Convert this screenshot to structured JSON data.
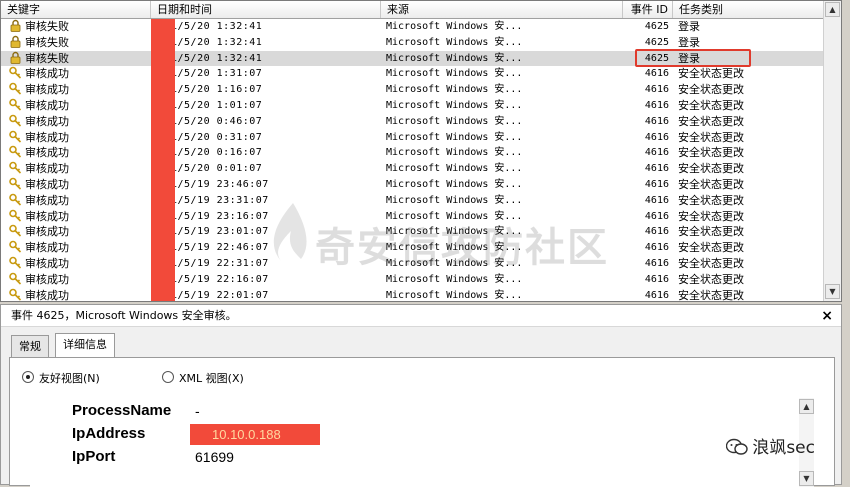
{
  "list": {
    "columns": [
      "关键字",
      "日期和时间",
      "来源",
      "事件 ID",
      "任务类别"
    ],
    "rows": [
      {
        "kw": "审核失败",
        "dt": "1/5/20 1:32:41",
        "src": "Microsoft Windows 安...",
        "id": "4625",
        "cat": "登录",
        "icon": "lock-icon"
      },
      {
        "kw": "审核失败",
        "dt": "1/5/20 1:32:41",
        "src": "Microsoft Windows 安...",
        "id": "4625",
        "cat": "登录",
        "icon": "lock-icon"
      },
      {
        "kw": "审核失败",
        "dt": "1/5/20 1:32:41",
        "src": "Microsoft Windows 安...",
        "id": "4625",
        "cat": "登录",
        "icon": "lock-icon"
      },
      {
        "kw": "审核成功",
        "dt": "1/5/20 1:31:07",
        "src": "Microsoft Windows 安...",
        "id": "4616",
        "cat": "安全状态更改",
        "icon": "key-icon"
      },
      {
        "kw": "审核成功",
        "dt": "1/5/20 1:16:07",
        "src": "Microsoft Windows 安...",
        "id": "4616",
        "cat": "安全状态更改",
        "icon": "key-icon"
      },
      {
        "kw": "审核成功",
        "dt": "1/5/20 1:01:07",
        "src": "Microsoft Windows 安...",
        "id": "4616",
        "cat": "安全状态更改",
        "icon": "key-icon"
      },
      {
        "kw": "审核成功",
        "dt": "1/5/20 0:46:07",
        "src": "Microsoft Windows 安...",
        "id": "4616",
        "cat": "安全状态更改",
        "icon": "key-icon"
      },
      {
        "kw": "审核成功",
        "dt": "1/5/20 0:31:07",
        "src": "Microsoft Windows 安...",
        "id": "4616",
        "cat": "安全状态更改",
        "icon": "key-icon"
      },
      {
        "kw": "审核成功",
        "dt": "1/5/20 0:16:07",
        "src": "Microsoft Windows 安...",
        "id": "4616",
        "cat": "安全状态更改",
        "icon": "key-icon"
      },
      {
        "kw": "审核成功",
        "dt": "1/5/20 0:01:07",
        "src": "Microsoft Windows 安...",
        "id": "4616",
        "cat": "安全状态更改",
        "icon": "key-icon"
      },
      {
        "kw": "审核成功",
        "dt": "1/5/19 23:46:07",
        "src": "Microsoft Windows 安...",
        "id": "4616",
        "cat": "安全状态更改",
        "icon": "key-icon"
      },
      {
        "kw": "审核成功",
        "dt": "1/5/19 23:31:07",
        "src": "Microsoft Windows 安...",
        "id": "4616",
        "cat": "安全状态更改",
        "icon": "key-icon"
      },
      {
        "kw": "审核成功",
        "dt": "1/5/19 23:16:07",
        "src": "Microsoft Windows 安...",
        "id": "4616",
        "cat": "安全状态更改",
        "icon": "key-icon"
      },
      {
        "kw": "审核成功",
        "dt": "1/5/19 23:01:07",
        "src": "Microsoft Windows 安...",
        "id": "4616",
        "cat": "安全状态更改",
        "icon": "key-icon"
      },
      {
        "kw": "审核成功",
        "dt": "1/5/19 22:46:07",
        "src": "Microsoft Windows 安...",
        "id": "4616",
        "cat": "安全状态更改",
        "icon": "key-icon"
      },
      {
        "kw": "审核成功",
        "dt": "1/5/19 22:31:07",
        "src": "Microsoft Windows 安...",
        "id": "4616",
        "cat": "安全状态更改",
        "icon": "key-icon"
      },
      {
        "kw": "审核成功",
        "dt": "1/5/19 22:16:07",
        "src": "Microsoft Windows 安...",
        "id": "4616",
        "cat": "安全状态更改",
        "icon": "key-icon"
      },
      {
        "kw": "审核成功",
        "dt": "1/5/19 22:01:07",
        "src": "Microsoft Windows 安...",
        "id": "4616",
        "cat": "安全状态更改",
        "icon": "key-icon"
      }
    ],
    "selected_row": 2
  },
  "watermark": {
    "text": "奇安信攻防社区"
  },
  "detail": {
    "title": "事件 4625，Microsoft Windows 安全审核。",
    "close": "×",
    "tabs": [
      "常规",
      "详细信息"
    ],
    "active_tab": 1,
    "radio_friendly": "友好视图(N)",
    "radio_xml": "XML 视图(X)",
    "fields": [
      {
        "key": "ProcessName",
        "value": "-"
      },
      {
        "key": "IpAddress",
        "value": "10.10.0.188"
      },
      {
        "key": "IpPort",
        "value": "61699"
      }
    ]
  },
  "brand": {
    "text": "浪飒sec"
  },
  "colors": {
    "redact": "#f24a3a",
    "highlight_box": "#e03a2c",
    "selected_row": "#d9d9d9"
  }
}
